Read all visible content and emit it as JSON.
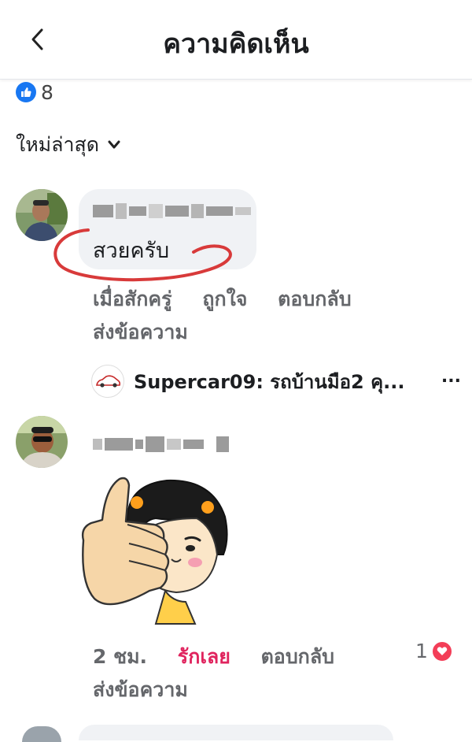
{
  "header": {
    "title": "ความคิดเห็น",
    "back_icon": "chevron-left-icon"
  },
  "reactions": {
    "count": "8",
    "icon": "like-icon",
    "color": "#1877f2"
  },
  "sort": {
    "label": "ใหม่ล่าสุด",
    "icon": "chevron-down-icon"
  },
  "comments": [
    {
      "text": "สวยครับ",
      "name_obscured": true,
      "annotation_color": "#d83a3a",
      "actions": [
        "เมื่อสักครู่",
        "ถูกใจ",
        "ตอบกลับ"
      ],
      "send_message": "ส่งข้อความ",
      "reply_preview": {
        "text": "Supercar09: รถบ้านมือ2 คุ...",
        "more": "..."
      }
    },
    {
      "name_obscured": true,
      "sticker": "thumbs-up-girl-sticker",
      "actions": [
        "2 ชม.",
        "รักเลย",
        "ตอบกลับ"
      ],
      "reaction_count": "1",
      "reaction_icon": "heart-icon",
      "send_message": "ส่งข้อความ"
    }
  ],
  "colors": {
    "love": "#e0245e",
    "meta": "#65676b"
  }
}
